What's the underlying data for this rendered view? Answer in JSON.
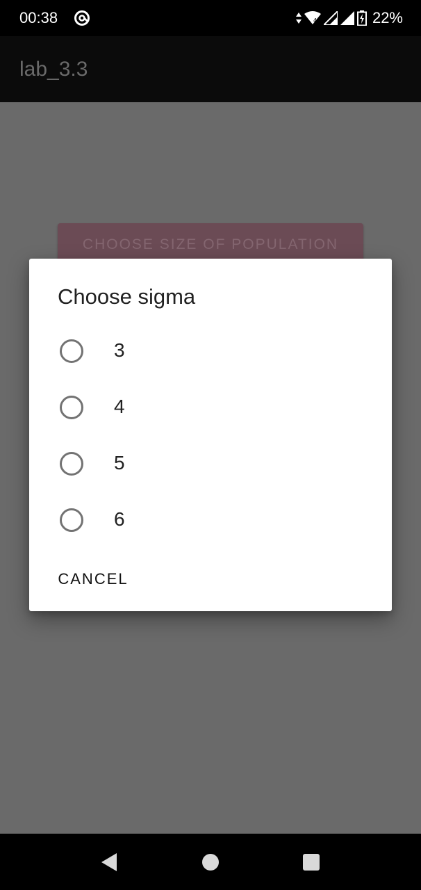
{
  "status_bar": {
    "time": "00:38",
    "battery_percent": "22%",
    "icons": [
      "at-sign-icon",
      "data-arrows-icon",
      "wifi-icon",
      "signal-icon",
      "signal-no-service-icon",
      "battery-charging-icon"
    ]
  },
  "app_bar": {
    "title": "lab_3.3"
  },
  "background": {
    "population_button_label": "CHOOSE SIZE OF POPULATION"
  },
  "dialog": {
    "title": "Choose sigma",
    "options": [
      {
        "label": "3",
        "selected": false
      },
      {
        "label": "4",
        "selected": false
      },
      {
        "label": "5",
        "selected": false
      },
      {
        "label": "6",
        "selected": false
      }
    ],
    "cancel_label": "CANCEL"
  },
  "nav_bar": {
    "icons": [
      "back-icon",
      "home-icon",
      "recents-icon"
    ]
  },
  "colors": {
    "scrim": "#6a6a6a",
    "dialog_bg": "#ffffff",
    "status_bar_bg": "#000000",
    "button_dimmed": "#6b4b55",
    "radio_outline": "#737373"
  }
}
